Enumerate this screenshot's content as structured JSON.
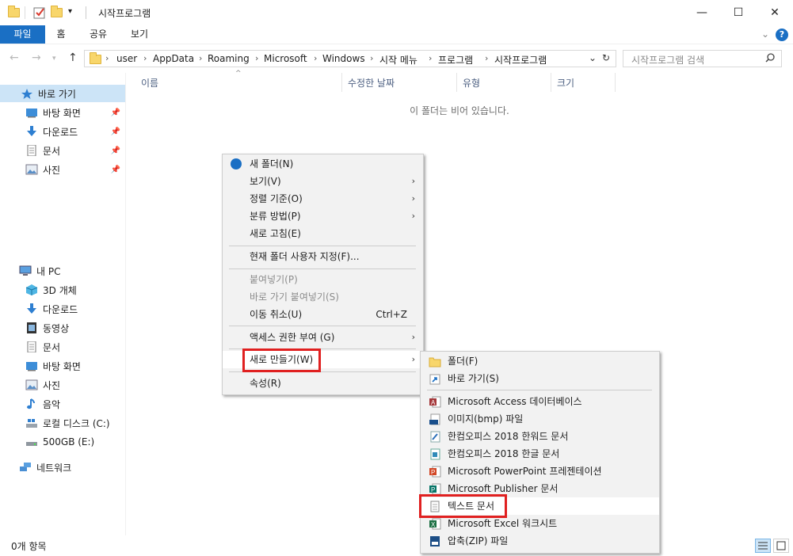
{
  "window": {
    "title": "시작프로그램",
    "minimize": "—",
    "maximize": "☐",
    "close": "✕"
  },
  "ribbon": {
    "tabs": [
      "파일",
      "홈",
      "공유",
      "보기"
    ],
    "expand": "⌄",
    "help": "?"
  },
  "address": {
    "crumbs": [
      "user",
      "AppData",
      "Roaming",
      "Microsoft",
      "Windows",
      "시작 메뉴",
      "프로그램",
      "시작프로그램"
    ],
    "search_placeholder": "시작프로그램 검색"
  },
  "sidebar": {
    "quick_access": "바로 가기",
    "pinned": [
      {
        "label": "바탕 화면",
        "icon": "desktop-icon"
      },
      {
        "label": "다운로드",
        "icon": "download-icon"
      },
      {
        "label": "문서",
        "icon": "document-icon"
      },
      {
        "label": "사진",
        "icon": "pictures-icon"
      }
    ],
    "this_pc": "내 PC",
    "pc_items": [
      {
        "label": "3D 개체",
        "icon": "3d-objects-icon"
      },
      {
        "label": "다운로드",
        "icon": "download-icon"
      },
      {
        "label": "동영상",
        "icon": "video-icon"
      },
      {
        "label": "문서",
        "icon": "document-icon"
      },
      {
        "label": "바탕 화면",
        "icon": "desktop-icon"
      },
      {
        "label": "사진",
        "icon": "pictures-icon"
      },
      {
        "label": "음악",
        "icon": "music-icon"
      },
      {
        "label": "로컬 디스크 (C:)",
        "icon": "local-disk-icon"
      },
      {
        "label": "500GB (E:)",
        "icon": "drive-icon"
      }
    ],
    "network": "네트워크"
  },
  "columns": [
    "이름",
    "수정한 날짜",
    "유형",
    "크기"
  ],
  "empty_message": "이 폴더는 비어 있습니다.",
  "context_menu": {
    "items": [
      {
        "label": "새 폴더(N)"
      },
      {
        "label": "보기(V)"
      },
      {
        "label": "정렬 기준(O)"
      },
      {
        "label": "분류 방법(P)"
      },
      {
        "label": "새로 고침(E)"
      },
      {
        "label": "현재 폴더 사용자 지정(F)..."
      },
      {
        "label": "붙여넣기(P)"
      },
      {
        "label": "바로 가기 붙여넣기(S)"
      },
      {
        "label": "이동 취소(U)",
        "shortcut": "Ctrl+Z"
      },
      {
        "label": "액세스 권한 부여 (G)"
      },
      {
        "label": "새로 만들기(W)"
      },
      {
        "label": "속성(R)"
      }
    ]
  },
  "submenu": {
    "items": [
      {
        "label": "폴더(F)"
      },
      {
        "label": "바로 가기(S)"
      },
      {
        "label": "Microsoft Access 데이터베이스"
      },
      {
        "label": "이미지(bmp) 파일"
      },
      {
        "label": "한컴오피스 2018 한워드 문서"
      },
      {
        "label": "한컴오피스 2018 한글 문서"
      },
      {
        "label": "Microsoft PowerPoint 프레젠테이션"
      },
      {
        "label": "Microsoft Publisher 문서"
      },
      {
        "label": "텍스트 문서"
      },
      {
        "label": "Microsoft Excel 워크시트"
      },
      {
        "label": "압축(ZIP) 파일"
      }
    ]
  },
  "status": {
    "count": "0개 항목"
  },
  "colors": {
    "accent": "#1a6fc4",
    "selection": "#cce4f7",
    "highlight_box": "#e02020"
  }
}
